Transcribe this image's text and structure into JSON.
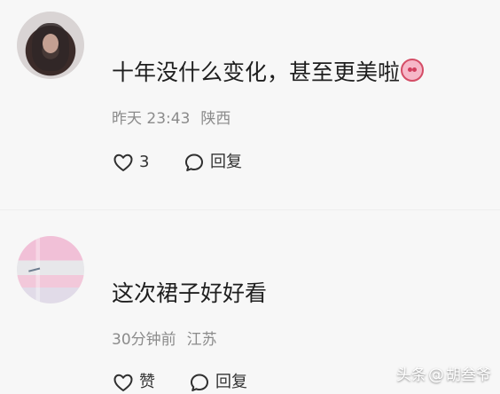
{
  "comments": [
    {
      "username": "",
      "avatar": "avatar-photo",
      "content": "十年没什么变化，甚至更美啦",
      "emoji": "blushing-face-icon",
      "time": "昨天 23:43",
      "location": "陕西",
      "likes": "3",
      "reply_label": "回复",
      "icons": {
        "like": "heart-icon",
        "reply": "speech-bubble-icon"
      }
    },
    {
      "username": "",
      "avatar": "avatar-pink-image",
      "content": "这次裙子好好看",
      "time": "30分钟前",
      "location": "江苏",
      "like_label": "赞",
      "reply_label": "回复",
      "icons": {
        "like": "heart-icon",
        "reply": "speech-bubble-icon"
      }
    }
  ],
  "watermark": {
    "platform": "头条",
    "at": "@",
    "author": "胡叁爷"
  },
  "colors": {
    "background": "#f7f7f7",
    "text": "#1f1f1f",
    "meta": "#8b8b8b",
    "icon": "#2f2f2f"
  }
}
